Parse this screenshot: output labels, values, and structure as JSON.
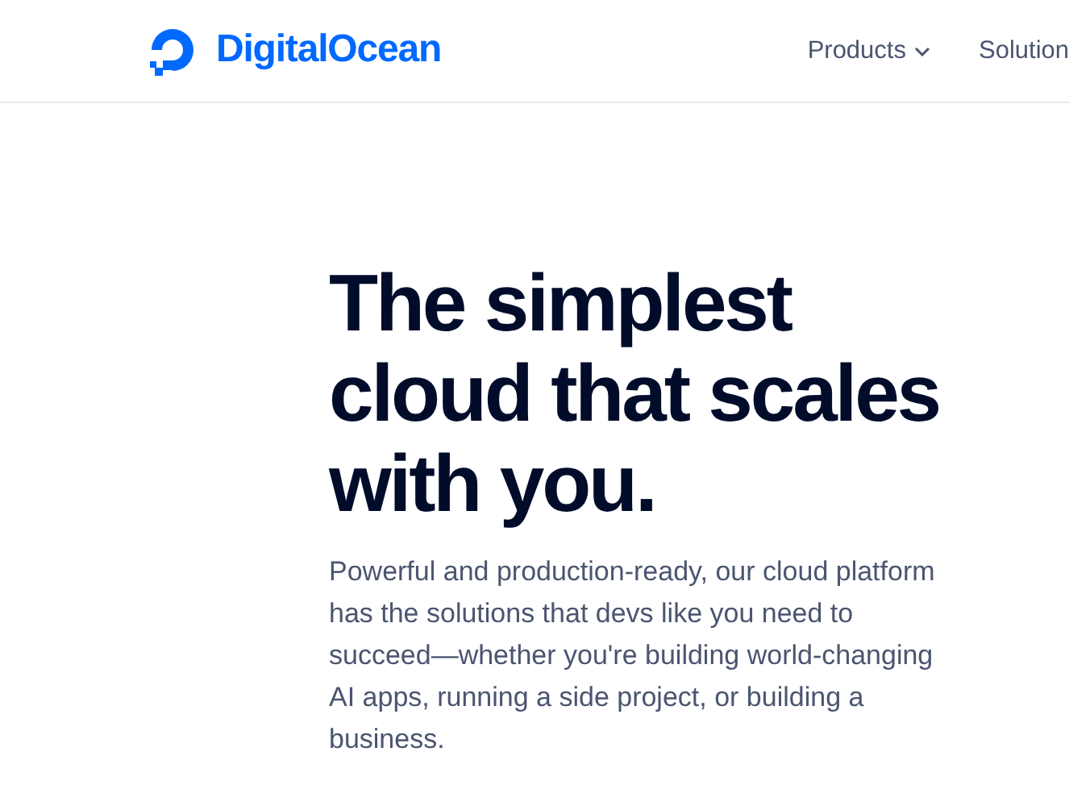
{
  "header": {
    "logo": "DigitalOcean",
    "nav": [
      {
        "label": "Products",
        "kind": "dropdown"
      },
      {
        "label": "Solution",
        "kind": "link"
      }
    ]
  },
  "hero": {
    "title": "The simplest cloud that scales with you.",
    "description": "Powerful and production-ready, our cloud platform has the solutions that devs like you need to succeed—whether you're building world-changing AI apps, running a side project, or building a business."
  }
}
